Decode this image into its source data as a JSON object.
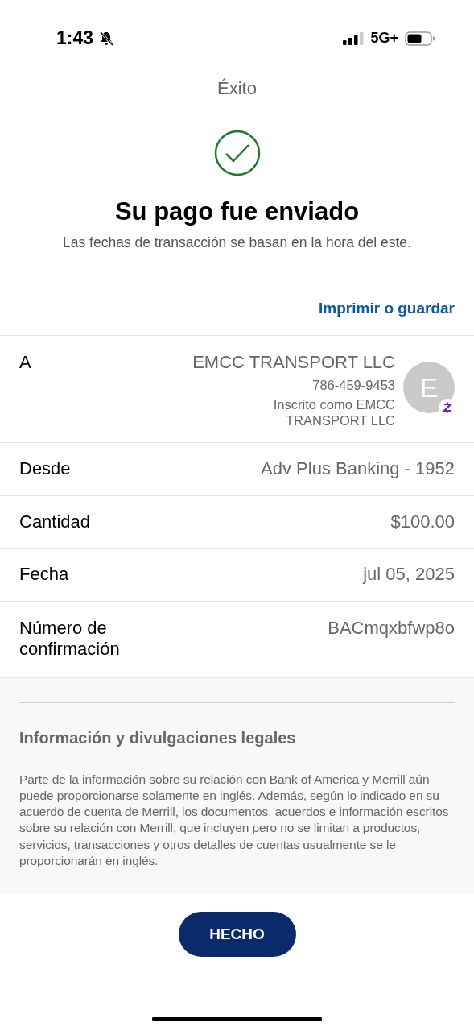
{
  "status_bar": {
    "time": "1:43",
    "network": "5G+"
  },
  "header": {
    "title": "Éxito"
  },
  "result": {
    "heading": "Su pago fue enviado",
    "note": "Las fechas de transacción se basan en la hora del este."
  },
  "print_link": "Imprimir o guardar",
  "recipient": {
    "label": "A",
    "name": "EMCC TRANSPORT LLC",
    "phone": "786-459-9453",
    "enrolled": "Inscrito como EMCC TRANSPORT LLC",
    "avatar_letter": "E"
  },
  "details": [
    {
      "label": "Desde",
      "value": "Adv Plus Banking - 1952"
    },
    {
      "label": "Cantidad",
      "value": "$100.00"
    },
    {
      "label": "Fecha",
      "value": "jul 05, 2025"
    },
    {
      "label": "Número de confirmación",
      "value": "BACmqxbfwp8o"
    }
  ],
  "legal": {
    "title": "Información y divulgaciones legales",
    "text": "Parte de la información sobre su relación con Bank of America y Merrill aún puede proporcionarse solamente en inglés. Además, según lo indicado en su acuerdo de cuenta de Merrill, los documentos, acuerdos e información escritos sobre su relación con Merrill, que incluyen pero no se limitan a productos, servicios, transacciones y otros detalles de cuentas usualmente se le proporcionarán en inglés."
  },
  "done_button": "HECHO"
}
